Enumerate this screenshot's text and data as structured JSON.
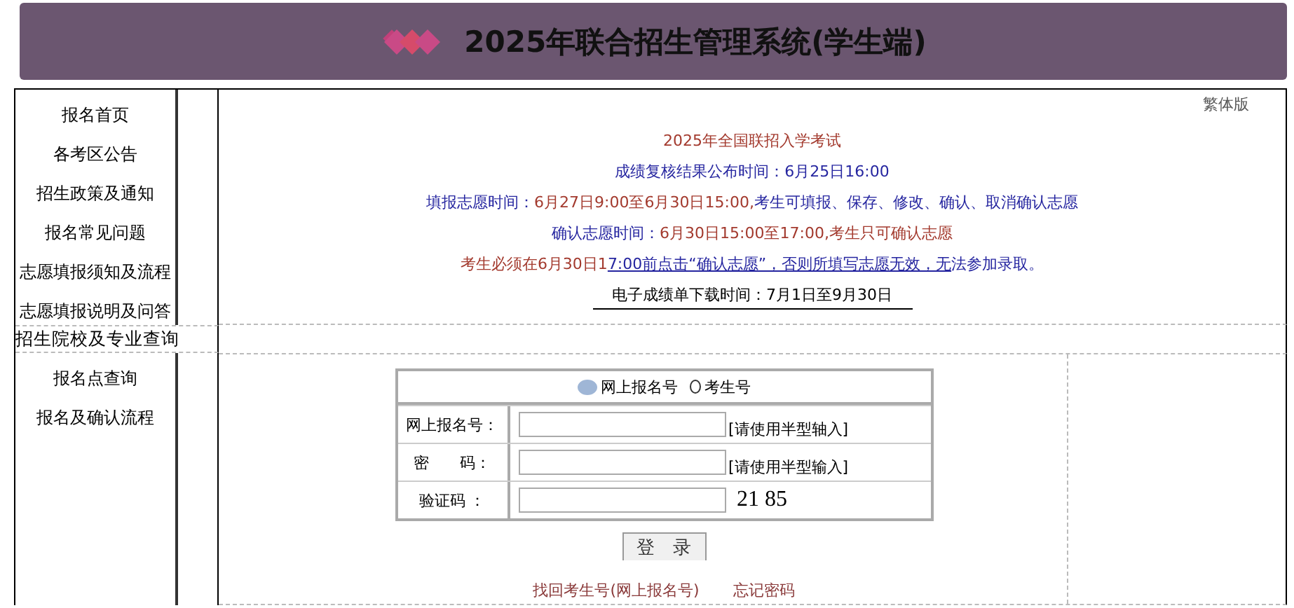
{
  "header": {
    "title": "2025年联合招生管理系统(学生端)"
  },
  "sidebar": {
    "items": [
      "报名首页",
      "各考区公告",
      "招生政策及通知",
      "报名常见问题",
      "志愿填报须知及流程",
      "志愿填报说明及问答"
    ],
    "section_link": "招生院校及专业查询",
    "items_2": [
      "报名点查询",
      "报名及确认流程"
    ]
  },
  "language_link": "繁体版",
  "notices": [
    {
      "kind": "title",
      "segments": [
        {
          "text": "2025年全国联招入学考试",
          "kind": "accent"
        }
      ]
    },
    {
      "kind": "plain",
      "segments": [
        {
          "text": "成绩复核结果公布时间：6月25日16:00",
          "kind": "info"
        }
      ]
    },
    {
      "kind": "plain",
      "segments": [
        {
          "text": "填报志愿时间：",
          "kind": "info"
        },
        {
          "text": "6月27日9:00至6月30日15:00,",
          "kind": "accent"
        },
        {
          "text": "考生可填报、保存、修改、确认、取消确认志愿",
          "kind": "info"
        }
      ]
    },
    {
      "kind": "plain",
      "segments": [
        {
          "text": "确认志愿时间：",
          "kind": "info"
        },
        {
          "text": "6月30日15:00至17:00,考生只可确认志愿",
          "kind": "accent"
        }
      ]
    },
    {
      "kind": "plain",
      "segments": [
        {
          "text": "考生必须在6月30日1",
          "kind": "accent"
        },
        {
          "text": "7:00前点击“确认志愿”，否则所填写志愿无效，无",
          "kind": "link"
        },
        {
          "text": "法参加录取。",
          "kind": "info"
        }
      ]
    },
    {
      "kind": "underlined",
      "segments": [
        {
          "text": "电子成绩单下载时间：7月1日至9月30日",
          "kind": "plain"
        }
      ]
    }
  ],
  "login": {
    "id_types": [
      {
        "label": "网上报名号",
        "selected": true
      },
      {
        "label": "考生号",
        "selected": false
      }
    ],
    "rows": [
      {
        "label": "网上报名号：",
        "kind": "text",
        "hint": "[请使用半型轴入]"
      },
      {
        "label": "密　　码：",
        "kind": "password",
        "hint": "[请使用半型输入]"
      },
      {
        "label": "验证码 ：",
        "kind": "captcha",
        "captcha": "21 85"
      }
    ],
    "submit": "登　录",
    "links": [
      "找回考生号(网上报名号)",
      "忘记密码"
    ]
  }
}
